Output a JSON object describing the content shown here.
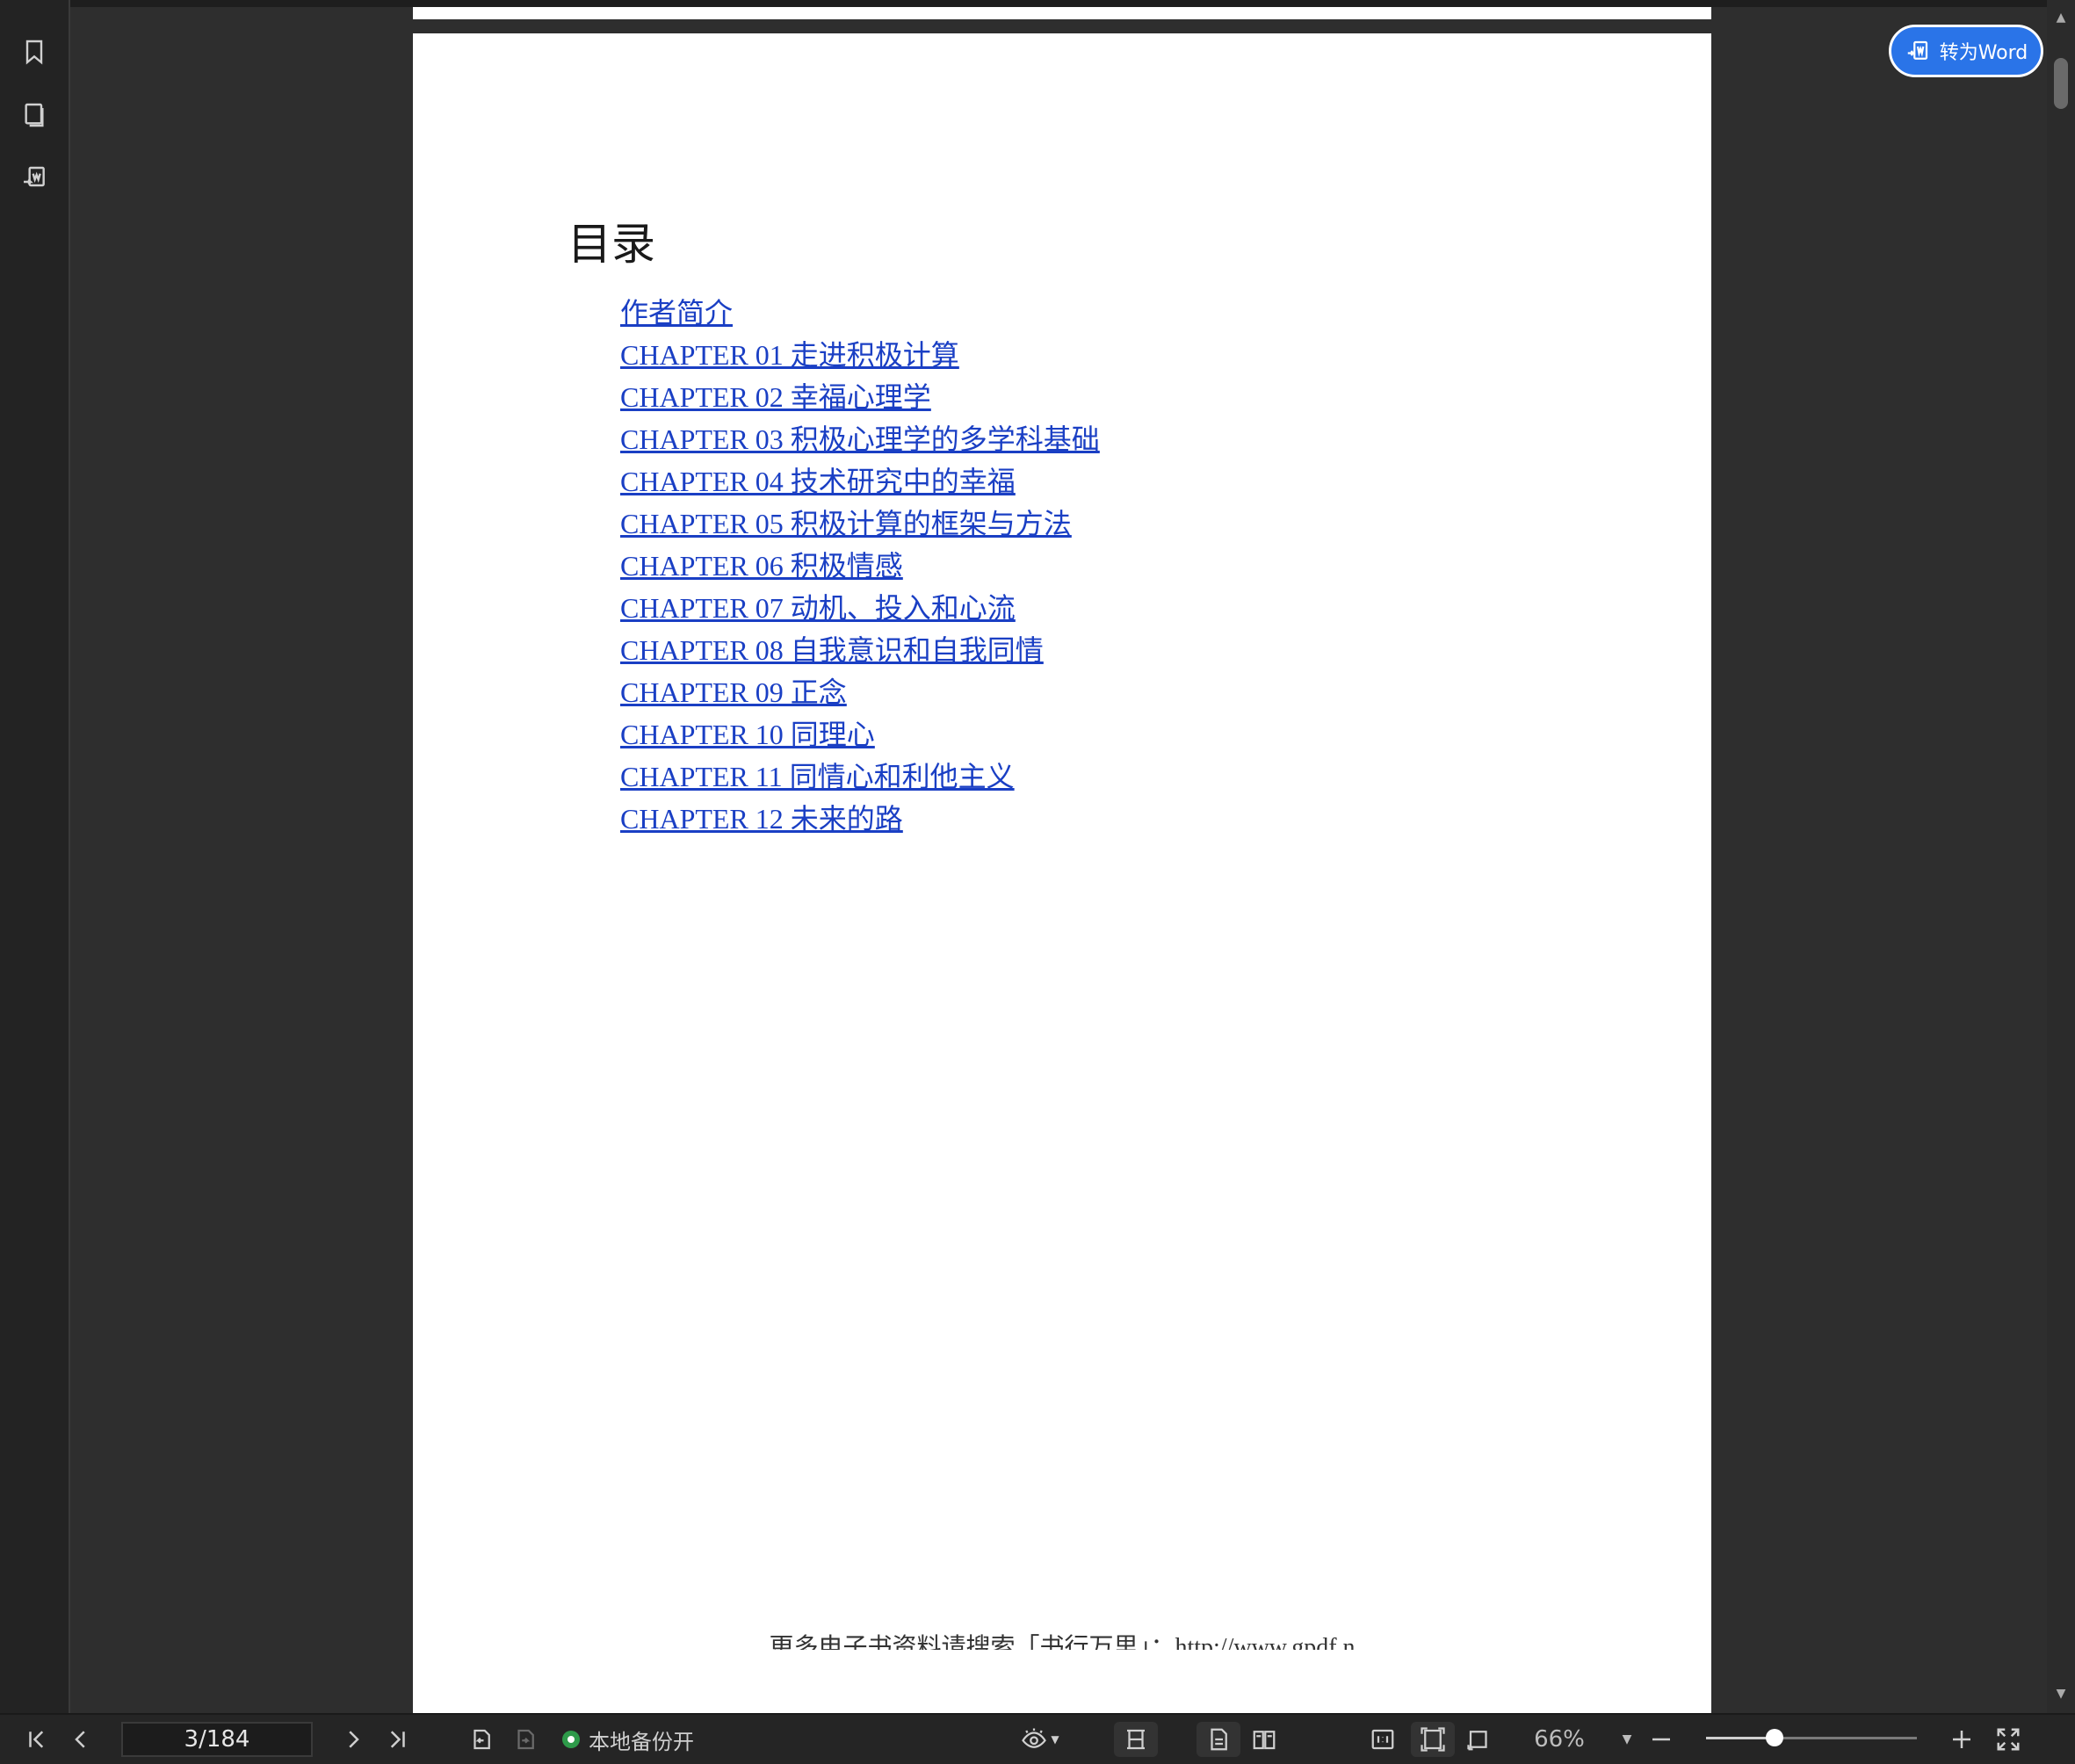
{
  "rail": {
    "icons": [
      "bookmark-icon",
      "thumbnails-icon",
      "convert-doc-icon"
    ]
  },
  "convert_button": {
    "label": "转为Word"
  },
  "page": {
    "toc_title": "目录",
    "toc_items": [
      "作者简介",
      "CHAPTER 01 走进积极计算",
      "CHAPTER 02 幸福心理学",
      "CHAPTER 03 积极心理学的多学科基础",
      "CHAPTER 04 技术研究中的幸福",
      "CHAPTER 05 积极计算的框架与方法",
      "CHAPTER 06 积极情感",
      "CHAPTER 07 动机、投入和心流",
      "CHAPTER 08 自我意识和自我同情",
      "CHAPTER 09 正念",
      "CHAPTER 10 同理心",
      "CHAPTER 11 同情心和利他主义",
      "CHAPTER 12 未来的路"
    ],
    "footer": "更多电子书资料请搜索「书行万里」：http://www.gpdf.n"
  },
  "toolbar": {
    "page_indicator": "3/184",
    "backup_label": "本地备份开",
    "zoom_label": "66%",
    "zoom_level_percent": 66,
    "colors": {
      "backup_dot": "#2e9a4a",
      "accent": "#2a74e8"
    }
  }
}
